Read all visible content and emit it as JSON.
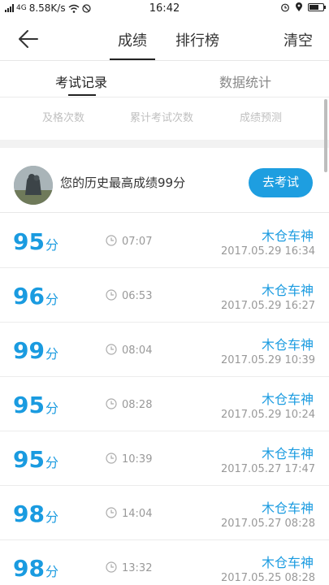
{
  "status_bar": {
    "signal_text": "4G",
    "net_speed": "8.58K/s",
    "time": "16:42",
    "battery_level": 0.7
  },
  "nav": {
    "back_icon": "back-arrow-icon",
    "tabs": [
      "成绩",
      "排行榜"
    ],
    "active_tab": 0,
    "clear_label": "清空"
  },
  "sub_tabs": {
    "items": [
      "考试记录",
      "数据统计"
    ],
    "active": 0
  },
  "stats": {
    "pass_count_label": "及格次数",
    "total_exam_label": "累计考试次数",
    "prediction_label": "成绩预测"
  },
  "best": {
    "text": "您的历史最高成绩99分",
    "button_label": "去考试"
  },
  "records": [
    {
      "score": "95",
      "unit": "分",
      "duration": "07:07",
      "user": "木仓车神",
      "date": "2017.05.29  16:34"
    },
    {
      "score": "96",
      "unit": "分",
      "duration": "06:53",
      "user": "木仓车神",
      "date": "2017.05.29  16:27"
    },
    {
      "score": "99",
      "unit": "分",
      "duration": "08:04",
      "user": "木仓车神",
      "date": "2017.05.29  10:39"
    },
    {
      "score": "95",
      "unit": "分",
      "duration": "08:28",
      "user": "木仓车神",
      "date": "2017.05.29  10:24"
    },
    {
      "score": "95",
      "unit": "分",
      "duration": "10:39",
      "user": "木仓车神",
      "date": "2017.05.27  17:47"
    },
    {
      "score": "98",
      "unit": "分",
      "duration": "14:04",
      "user": "木仓车神",
      "date": "2017.05.27  08:28"
    },
    {
      "score": "98",
      "unit": "分",
      "duration": "13:32",
      "user": "木仓车神",
      "date": "2017.05.25  08:28"
    }
  ],
  "colors": {
    "accent": "#1a9be0",
    "button": "#1e9ee0"
  }
}
